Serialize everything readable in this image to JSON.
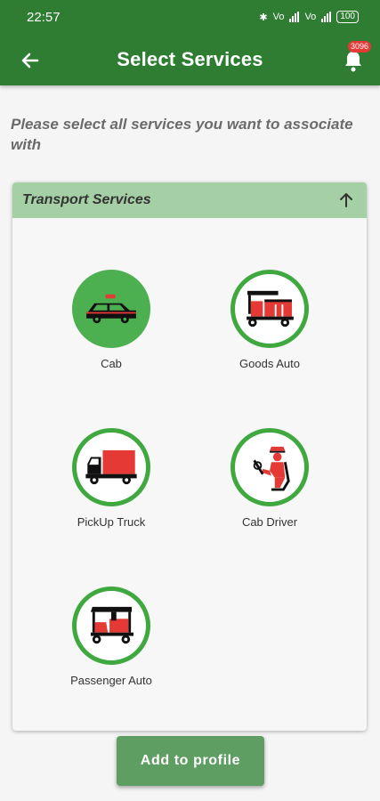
{
  "status": {
    "time": "22:57",
    "signal1": "Vo",
    "signal2": "Vo",
    "battery": "100"
  },
  "header": {
    "title": "Select Services",
    "notification_count": "3096"
  },
  "intro_text": "Please select all services you want to associate with",
  "section": {
    "title": "Transport Services",
    "services": [
      {
        "label": "Cab",
        "icon": "taxi-car-icon",
        "selected": true
      },
      {
        "label": "Goods Auto",
        "icon": "goods-auto-icon",
        "selected": false
      },
      {
        "label": "PickUp Truck",
        "icon": "pickup-truck-icon",
        "selected": false
      },
      {
        "label": "Cab Driver",
        "icon": "driver-icon",
        "selected": false
      },
      {
        "label": "Passenger Auto",
        "icon": "passenger-auto-icon",
        "selected": false
      }
    ]
  },
  "actions": {
    "add_label": "Add to profile"
  },
  "colors": {
    "primary": "#2e7d32",
    "selected": "#4caf50",
    "header_bg": "#a5cfa5",
    "button": "#5f9e63",
    "accent_red": "#e53935"
  }
}
